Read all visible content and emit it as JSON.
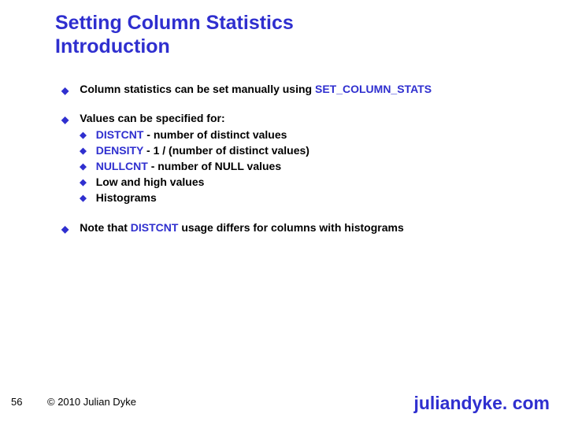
{
  "title_line1": "Setting Column Statistics",
  "title_line2": "Introduction",
  "bullets": {
    "b1_pre": "Column statistics can  be set manually using ",
    "b1_kw": "SET_COLUMN_STATS",
    "b2_lead": "Values can be specified for:",
    "b2_sub_kw1": "DISTCNT",
    "b2_sub_txt1": " - number of distinct values",
    "b2_sub_kw2": "DENSITY",
    "b2_sub_txt2": " - 1 / (number of distinct values)",
    "b2_sub_kw3": "NULLCNT",
    "b2_sub_txt3": " - number of NULL values",
    "b2_sub4": "Low and high values",
    "b2_sub5": "Histograms",
    "b3_pre": "Note that ",
    "b3_kw": "DISTCNT",
    "b3_post": " usage differs for columns with histograms"
  },
  "footer": {
    "page": "56",
    "copyright": "© 2010 Julian Dyke",
    "site": "juliandyke. com"
  }
}
